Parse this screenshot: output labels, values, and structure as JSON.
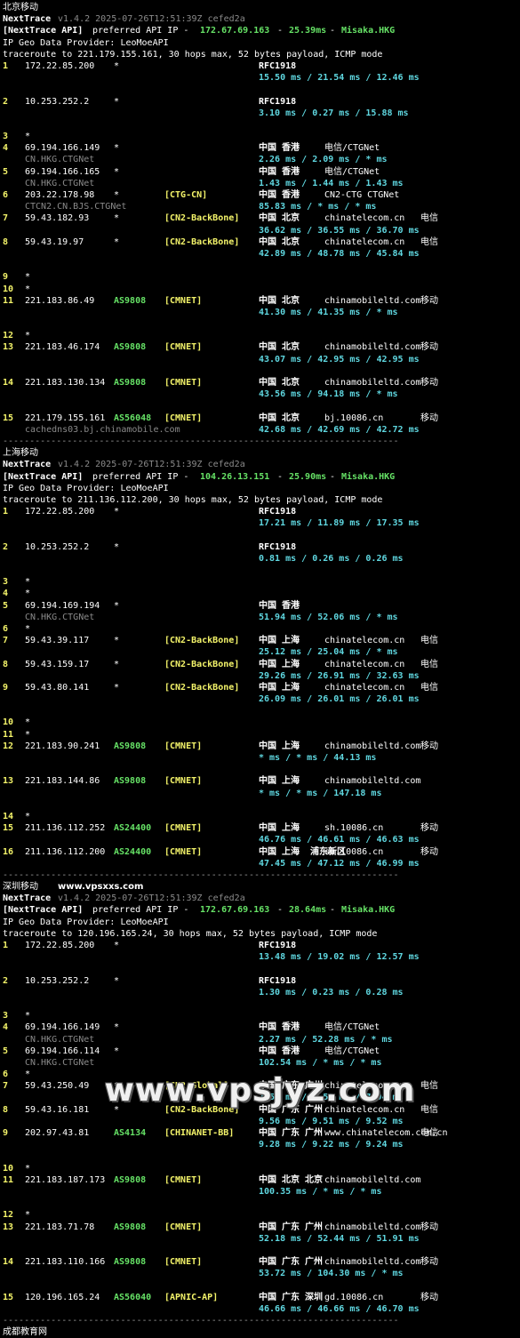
{
  "sections": [
    {
      "title": "北京移动",
      "site": "",
      "nt_version": "v1.4.2 2025-07-26T12:51:39Z cefed2a",
      "api_prefix": "[NextTrace API]",
      "api_label": " preferred API IP - ",
      "api_ip": "172.67.69.163",
      "api_latency": "25.39ms",
      "api_node": "Misaka.HKG",
      "geo_provider": "IP Geo Data Provider: LeoMoeAPI",
      "traceroute": "traceroute to 221.179.155.161, 30 hops max, 52 bytes payload, ICMP mode",
      "separator": "--------------------------------------------------------------------------",
      "hops": [
        {
          "n": "1",
          "ip": "172.22.85.200",
          "as": "*",
          "tag": "",
          "geo": "RFC1918",
          "owner": "",
          "isp": "",
          "rtt": "15.50 ms / 21.54 ms / 12.46 ms",
          "host": "",
          "blank": true
        },
        {
          "n": "2",
          "ip": "10.253.252.2",
          "as": "*",
          "tag": "",
          "geo": "RFC1918",
          "owner": "",
          "isp": "",
          "rtt": "3.10 ms / 0.27 ms / 15.88 ms",
          "host": "",
          "blank": true
        },
        {
          "n": "3",
          "ip": "*",
          "star": true
        },
        {
          "n": "4",
          "ip": "69.194.166.149",
          "as": "*",
          "tag": "",
          "geo": "中国 香港",
          "owner": "电信/CTGNet",
          "isp": "",
          "rtt": "2.26 ms / 2.09 ms / * ms",
          "host": "CN.HKG.CTGNet"
        },
        {
          "n": "5",
          "ip": "69.194.166.165",
          "as": "*",
          "tag": "",
          "geo": "中国 香港",
          "owner": "电信/CTGNet",
          "isp": "",
          "rtt": "1.43 ms / 1.44 ms / 1.43 ms",
          "host": "CN.HKG.CTGNet"
        },
        {
          "n": "6",
          "ip": "203.22.178.98",
          "as": "*",
          "tag": "[CTG-CN]",
          "geo": "中国 香港",
          "owner": "CN2-CTG CTGNet",
          "isp": "",
          "rtt": "85.83 ms / * ms / * ms",
          "host": "CTCN2.CN.BJS.CTGNet"
        },
        {
          "n": "7",
          "ip": "59.43.182.93",
          "as": "*",
          "tag": "[CN2-BackBone]",
          "geo": "中国 北京",
          "owner": "chinatelecom.cn",
          "isp": "电信",
          "rtt": "36.62 ms / 36.55 ms / 36.70 ms",
          "host": ""
        },
        {
          "n": "8",
          "ip": "59.43.19.97",
          "as": "*",
          "tag": "[CN2-BackBone]",
          "geo": "中国 北京",
          "owner": "chinatelecom.cn",
          "isp": "电信",
          "rtt": "42.89 ms / 48.78 ms / 45.84 ms",
          "host": "",
          "blank": true
        },
        {
          "n": "9",
          "ip": "*",
          "star": true
        },
        {
          "n": "10",
          "ip": "*",
          "star": true
        },
        {
          "n": "11",
          "ip": "221.183.86.49",
          "as": "AS9808",
          "tag": "[CMNET]",
          "geo": "中国 北京",
          "owner": "chinamobileltd.com",
          "isp": "移动",
          "rtt": "41.30 ms / 41.35 ms / * ms",
          "host": "",
          "blank": true
        },
        {
          "n": "12",
          "ip": "*",
          "star": true
        },
        {
          "n": "13",
          "ip": "221.183.46.174",
          "as": "AS9808",
          "tag": "[CMNET]",
          "geo": "中国 北京",
          "owner": "chinamobileltd.com",
          "isp": "移动",
          "rtt": "43.07 ms / 42.95 ms / 42.95 ms",
          "host": "",
          "blank": true
        },
        {
          "n": "14",
          "ip": "221.183.130.134",
          "as": "AS9808",
          "tag": "[CMNET]",
          "geo": "中国 北京",
          "owner": "chinamobileltd.com",
          "isp": "移动",
          "rtt": "43.56 ms / 94.18 ms / * ms",
          "host": "",
          "blank": true
        },
        {
          "n": "15",
          "ip": "221.179.155.161",
          "as": "AS56048",
          "tag": "[CMNET]",
          "geo": "中国 北京",
          "owner": "bj.10086.cn",
          "isp": "移动",
          "rtt": "42.68 ms / 42.69 ms / 42.72 ms",
          "host": "cachedns03.bj.chinamobile.com"
        }
      ]
    },
    {
      "title": "上海移动",
      "site": "",
      "nt_version": "v1.4.2 2025-07-26T12:51:39Z cefed2a",
      "api_prefix": "[NextTrace API]",
      "api_label": " preferred API IP - ",
      "api_ip": "104.26.13.151",
      "api_latency": "25.90ms",
      "api_node": "Misaka.HKG",
      "geo_provider": "IP Geo Data Provider: LeoMoeAPI",
      "traceroute": "traceroute to 211.136.112.200, 30 hops max, 52 bytes payload, ICMP mode",
      "separator": "--------------------------------------------------------------------------",
      "hops": [
        {
          "n": "1",
          "ip": "172.22.85.200",
          "as": "*",
          "tag": "",
          "geo": "RFC1918",
          "owner": "",
          "isp": "",
          "rtt": "17.21 ms / 11.89 ms / 17.35 ms",
          "host": "",
          "blank": true
        },
        {
          "n": "2",
          "ip": "10.253.252.2",
          "as": "*",
          "tag": "",
          "geo": "RFC1918",
          "owner": "",
          "isp": "",
          "rtt": "0.81 ms / 0.26 ms / 0.26 ms",
          "host": "",
          "blank": true
        },
        {
          "n": "3",
          "ip": "*",
          "star": true
        },
        {
          "n": "4",
          "ip": "*",
          "star": true
        },
        {
          "n": "5",
          "ip": "69.194.169.194",
          "as": "*",
          "tag": "",
          "geo": "中国 香港",
          "owner": "",
          "isp": "",
          "rtt": "51.94 ms / 52.06 ms / * ms",
          "host": "CN.HKG.CTGNet"
        },
        {
          "n": "6",
          "ip": "*",
          "star": true
        },
        {
          "n": "7",
          "ip": "59.43.39.117",
          "as": "*",
          "tag": "[CN2-BackBone]",
          "geo": "中国 上海",
          "owner": "chinatelecom.cn",
          "isp": "电信",
          "rtt": "25.12 ms / 25.04 ms / * ms",
          "host": ""
        },
        {
          "n": "8",
          "ip": "59.43.159.17",
          "as": "*",
          "tag": "[CN2-BackBone]",
          "geo": "中国 上海",
          "owner": "chinatelecom.cn",
          "isp": "电信",
          "rtt": "29.26 ms / 26.91 ms / 32.63 ms",
          "host": ""
        },
        {
          "n": "9",
          "ip": "59.43.80.141",
          "as": "*",
          "tag": "[CN2-BackBone]",
          "geo": "中国 上海",
          "owner": "chinatelecom.cn",
          "isp": "电信",
          "rtt": "26.09 ms / 26.01 ms / 26.01 ms",
          "host": "",
          "blank": true
        },
        {
          "n": "10",
          "ip": "*",
          "star": true
        },
        {
          "n": "11",
          "ip": "*",
          "star": true
        },
        {
          "n": "12",
          "ip": "221.183.90.241",
          "as": "AS9808",
          "tag": "[CMNET]",
          "geo": "中国 上海",
          "owner": "chinamobileltd.com",
          "isp": "移动",
          "rtt": "* ms / * ms / 44.13 ms",
          "host": "",
          "blank": true
        },
        {
          "n": "13",
          "ip": "221.183.144.86",
          "as": "AS9808",
          "tag": "[CMNET]",
          "geo": "中国 上海",
          "owner": "chinamobileltd.com",
          "isp": "",
          "rtt": "* ms / * ms / 147.18 ms",
          "host": "",
          "blank": true
        },
        {
          "n": "14",
          "ip": "*",
          "star": true
        },
        {
          "n": "15",
          "ip": "211.136.112.252",
          "as": "AS24400",
          "tag": "[CMNET]",
          "geo": "中国 上海",
          "owner": "sh.10086.cn",
          "isp": "移动",
          "rtt": "46.76 ms / 46.61 ms / 46.63 ms",
          "host": ""
        },
        {
          "n": "16",
          "ip": "211.136.112.200",
          "as": "AS24400",
          "tag": "[CMNET]",
          "geo": "中国 上海  浦东新区",
          "owner": "sh.10086.cn",
          "isp": "移动",
          "rtt": "47.45 ms / 47.12 ms / 46.99 ms",
          "host": ""
        }
      ]
    },
    {
      "title": "深圳移动",
      "site": "www.vpsxxs.com",
      "nt_version": "v1.4.2 2025-07-26T12:51:39Z cefed2a",
      "api_prefix": "[NextTrace API]",
      "api_label": " preferred API IP - ",
      "api_ip": "172.67.69.163",
      "api_latency": "28.64ms",
      "api_node": "Misaka.HKG",
      "geo_provider": "IP Geo Data Provider: LeoMoeAPI",
      "traceroute": "traceroute to 120.196.165.24, 30 hops max, 52 bytes payload, ICMP mode",
      "separator": "--------------------------------------------------------------------------",
      "hops": [
        {
          "n": "1",
          "ip": "172.22.85.200",
          "as": "*",
          "tag": "",
          "geo": "RFC1918",
          "owner": "",
          "isp": "",
          "rtt": "13.48 ms / 19.02 ms / 12.57 ms",
          "host": "",
          "blank": true
        },
        {
          "n": "2",
          "ip": "10.253.252.2",
          "as": "*",
          "tag": "",
          "geo": "RFC1918",
          "owner": "",
          "isp": "",
          "rtt": "1.30 ms / 0.23 ms / 0.28 ms",
          "host": "",
          "blank": true
        },
        {
          "n": "3",
          "ip": "*",
          "star": true
        },
        {
          "n": "4",
          "ip": "69.194.166.149",
          "as": "*",
          "tag": "",
          "geo": "中国 香港",
          "owner": "电信/CTGNet",
          "isp": "",
          "rtt": "2.27 ms / 52.28 ms / * ms",
          "host": "CN.HKG.CTGNet"
        },
        {
          "n": "5",
          "ip": "69.194.166.114",
          "as": "*",
          "tag": "",
          "geo": "中国 香港",
          "owner": "电信/CTGNet",
          "isp": "",
          "rtt": "102.54 ms / * ms / * ms",
          "host": "CN.HKG.CTGNet"
        },
        {
          "n": "6",
          "ip": "*",
          "star": true
        },
        {
          "n": "7",
          "ip": "59.43.250.49",
          "as": "*",
          "tag": "[CN2-Global]",
          "geo": "中国 广东 广州",
          "owner": "chinatelecom.cn",
          "isp": "电信",
          "rtt": "7.58 ms / 7.59 ms / 7.94 ms",
          "host": ""
        },
        {
          "n": "8",
          "ip": "59.43.16.181",
          "as": "*",
          "tag": "[CN2-BackBone]",
          "geo": "中国 广东 广州",
          "owner": "chinatelecom.cn",
          "isp": "电信",
          "rtt": "9.56 ms / 9.51 ms / 9.52 ms",
          "host": ""
        },
        {
          "n": "9",
          "ip": "202.97.43.81",
          "as": "AS4134",
          "tag": "[CHINANET-BB]",
          "geo": "中国 广东 广州",
          "owner": "www.chinatelecom.com.cn",
          "isp": "电信",
          "rtt": "9.28 ms / 9.22 ms / 9.24 ms",
          "host": "",
          "blank": true
        },
        {
          "n": "10",
          "ip": "*",
          "star": true
        },
        {
          "n": "11",
          "ip": "221.183.187.173",
          "as": "AS9808",
          "tag": "[CMNET]",
          "geo": "中国 北京 北京",
          "owner": "chinamobileltd.com",
          "isp": "",
          "rtt": "100.35 ms / * ms / * ms",
          "host": "",
          "blank": true
        },
        {
          "n": "12",
          "ip": "*",
          "star": true
        },
        {
          "n": "13",
          "ip": "221.183.71.78",
          "as": "AS9808",
          "tag": "[CMNET]",
          "geo": "中国 广东 广州",
          "owner": "chinamobileltd.com",
          "isp": "移动",
          "rtt": "52.18 ms / 52.44 ms / 51.91 ms",
          "host": "",
          "blank": true
        },
        {
          "n": "14",
          "ip": "221.183.110.166",
          "as": "AS9808",
          "tag": "[CMNET]",
          "geo": "中国 广东 广州",
          "owner": "chinamobileltd.com",
          "isp": "移动",
          "rtt": "53.72 ms / 104.30 ms / * ms",
          "host": "",
          "blank": true
        },
        {
          "n": "15",
          "ip": "120.196.165.24",
          "as": "AS56040",
          "tag": "[APNIC-AP]",
          "geo": "中国 广东 深圳",
          "owner": "gd.10086.cn",
          "isp": "移动",
          "rtt": "46.66 ms / 46.66 ms / 46.70 ms",
          "host": ""
        }
      ]
    }
  ],
  "footer_partial": "成都教育网",
  "watermark": "www.vpsjyz.com"
}
